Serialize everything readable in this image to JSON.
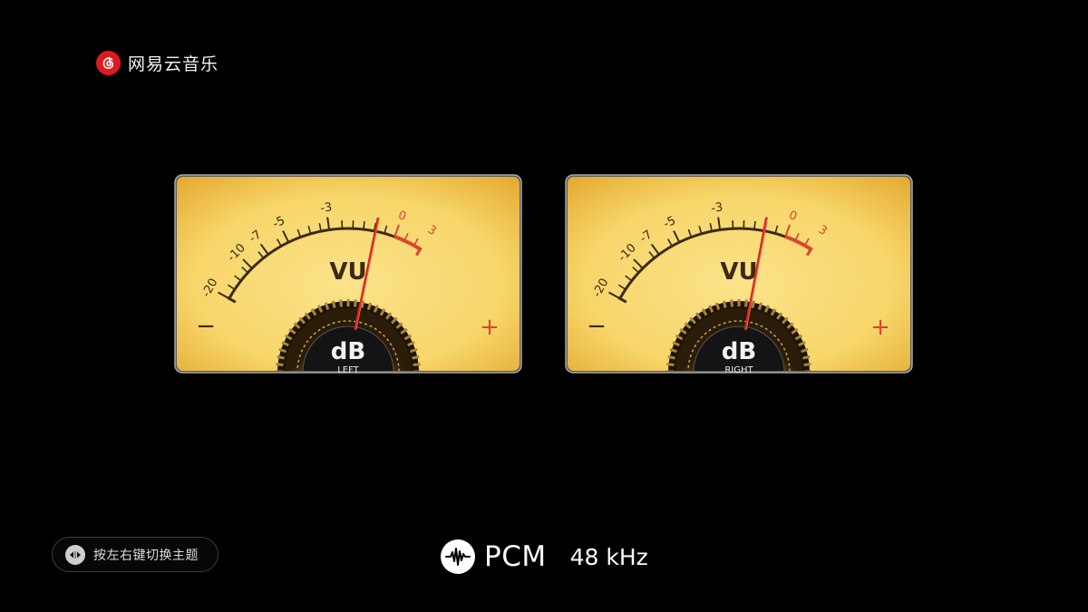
{
  "app": {
    "name": "网易云音乐",
    "logo_icon": "netease-music-logo-icon",
    "brand_color": "#e0191f"
  },
  "meters": [
    {
      "id": "left",
      "title": "VU",
      "unit": "dB",
      "channel": "LEFT",
      "needle_level_db": -0.9,
      "scale_labels": [
        "-20",
        "-10",
        "-7",
        "-5",
        "-3",
        "0",
        "3"
      ],
      "minus_sign": "−",
      "plus_sign": "+"
    },
    {
      "id": "right",
      "title": "VU",
      "unit": "dB",
      "channel": "RIGHT",
      "needle_level_db": -1.0,
      "scale_labels": [
        "-20",
        "-10",
        "-7",
        "-5",
        "-3",
        "0",
        "3"
      ],
      "minus_sign": "−",
      "plus_sign": "+"
    }
  ],
  "colors": {
    "dial_face": "#f7d66a",
    "dial_edge": "#e3a72e",
    "red_zone": "#d9452e",
    "needle": "#d6281f",
    "scale_ink": "#3a2a14"
  },
  "footer": {
    "theme_hint": "按左右键切换主题",
    "theme_hint_icon": "left-right-arrows-icon",
    "format_icon": "waveform-icon",
    "format": "PCM",
    "sample_rate": "48 kHz"
  }
}
